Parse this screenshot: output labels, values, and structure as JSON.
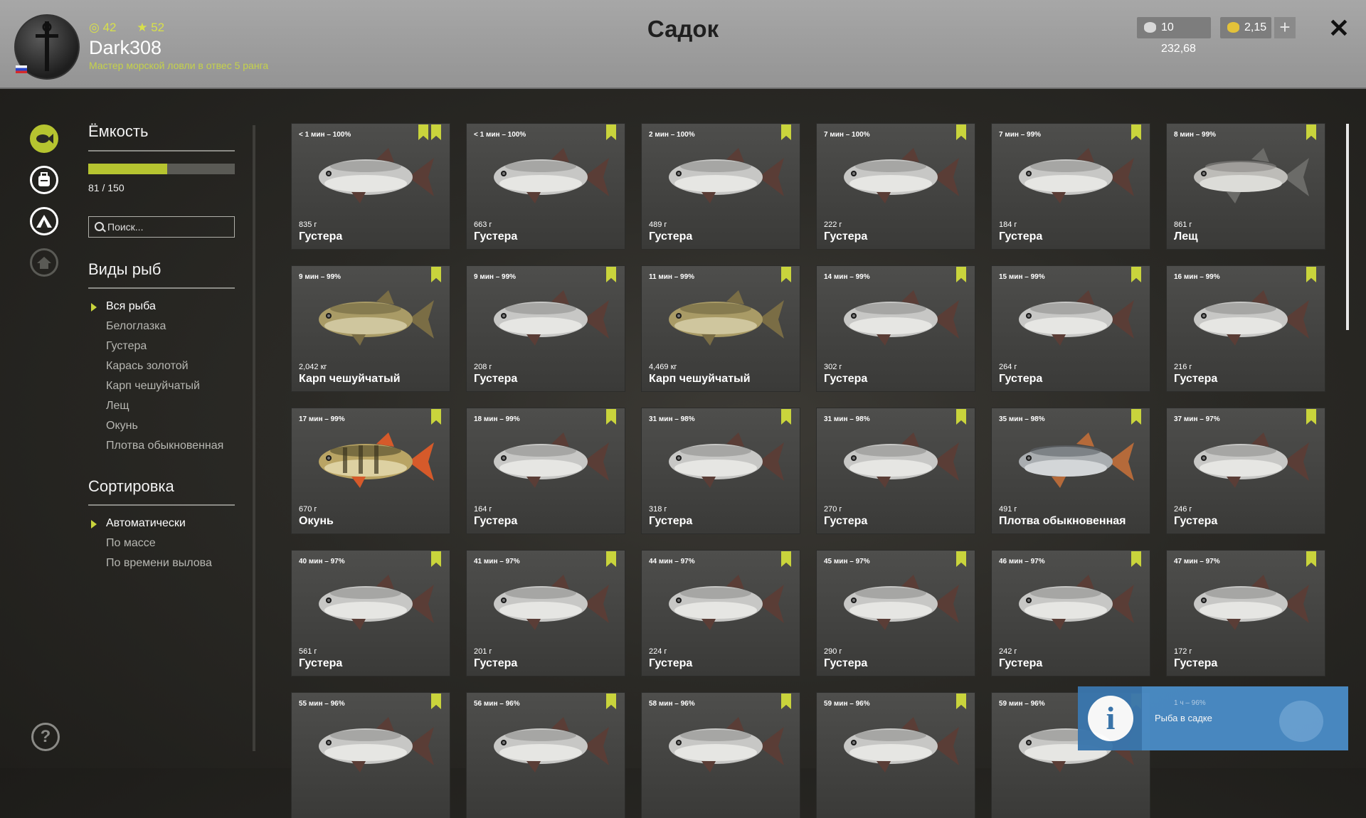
{
  "header": {
    "title": "Садок",
    "player": {
      "level": "42",
      "rank_stars": "52",
      "name": "Dark308",
      "rank_title": "Мастер морской ловли в отвес 5 ранга",
      "flag": "RU"
    },
    "currency": {
      "silver": "10 232,68",
      "gold": "2,15",
      "add_label": "+"
    },
    "close_label": "✕"
  },
  "nav": {
    "icons": [
      "keepnet-fish-icon",
      "backpack-icon",
      "camp-icon",
      "home-icon"
    ],
    "help_label": "?"
  },
  "capacity": {
    "title": "Ёмкость",
    "current": 81,
    "max": 150,
    "text": "81 / 150",
    "search_placeholder": "Поиск..."
  },
  "filters": {
    "title": "Виды рыб",
    "items": [
      "Вся рыба",
      "Белоглазка",
      "Густера",
      "Карась золотой",
      "Карп чешуйчатый",
      "Лещ",
      "Окунь",
      "Плотва обыкновенная"
    ],
    "selected": "Вся рыба"
  },
  "sorting": {
    "title": "Сортировка",
    "items": [
      "Автоматически",
      "По массе",
      "По времени вылова"
    ],
    "selected": "Автоматически"
  },
  "colors": {
    "accent": "#c9d43c",
    "header_bg": "#9e9e9e",
    "toast_bg": "#4a8cc6"
  },
  "fish": [
    {
      "time": "< 1 мин – 100%",
      "weight": "835 г",
      "name": "Густера",
      "kind": "bream",
      "star": true
    },
    {
      "time": "< 1 мин – 100%",
      "weight": "663 г",
      "name": "Густера",
      "kind": "bream"
    },
    {
      "time": "2 мин – 100%",
      "weight": "489 г",
      "name": "Густера",
      "kind": "bream"
    },
    {
      "time": "7 мин – 100%",
      "weight": "222 г",
      "name": "Густера",
      "kind": "bream"
    },
    {
      "time": "7 мин – 99%",
      "weight": "184 г",
      "name": "Густера",
      "kind": "bream"
    },
    {
      "time": "8 мин – 99%",
      "weight": "861 г",
      "name": "Лещ",
      "kind": "lesch"
    },
    {
      "time": "9 мин – 99%",
      "weight": "2,042 кг",
      "name": "Карп чешуйчатый",
      "kind": "carp"
    },
    {
      "time": "9 мин – 99%",
      "weight": "208 г",
      "name": "Густера",
      "kind": "bream"
    },
    {
      "time": "11 мин – 99%",
      "weight": "4,469 кг",
      "name": "Карп чешуйчатый",
      "kind": "carp"
    },
    {
      "time": "14 мин – 99%",
      "weight": "302 г",
      "name": "Густера",
      "kind": "bream"
    },
    {
      "time": "15 мин – 99%",
      "weight": "264 г",
      "name": "Густера",
      "kind": "bream"
    },
    {
      "time": "16 мин – 99%",
      "weight": "216 г",
      "name": "Густера",
      "kind": "bream"
    },
    {
      "time": "17 мин – 99%",
      "weight": "670 г",
      "name": "Окунь",
      "kind": "perch"
    },
    {
      "time": "18 мин – 99%",
      "weight": "164 г",
      "name": "Густера",
      "kind": "bream"
    },
    {
      "time": "31 мин – 98%",
      "weight": "318 г",
      "name": "Густера",
      "kind": "bream"
    },
    {
      "time": "31 мин – 98%",
      "weight": "270 г",
      "name": "Густера",
      "kind": "bream"
    },
    {
      "time": "35 мин – 98%",
      "weight": "491 г",
      "name": "Плотва обыкновенная",
      "kind": "roach"
    },
    {
      "time": "37 мин – 97%",
      "weight": "246 г",
      "name": "Густера",
      "kind": "bream"
    },
    {
      "time": "40 мин – 97%",
      "weight": "561 г",
      "name": "Густера",
      "kind": "bream"
    },
    {
      "time": "41 мин – 97%",
      "weight": "201 г",
      "name": "Густера",
      "kind": "bream"
    },
    {
      "time": "44 мин – 97%",
      "weight": "224 г",
      "name": "Густера",
      "kind": "bream"
    },
    {
      "time": "45 мин – 97%",
      "weight": "290 г",
      "name": "Густера",
      "kind": "bream"
    },
    {
      "time": "46 мин – 97%",
      "weight": "242 г",
      "name": "Густера",
      "kind": "bream"
    },
    {
      "time": "47 мин – 97%",
      "weight": "172 г",
      "name": "Густера",
      "kind": "bream"
    },
    {
      "time": "55 мин – 96%",
      "weight": "",
      "name": "",
      "kind": "bream"
    },
    {
      "time": "56 мин – 96%",
      "weight": "",
      "name": "",
      "kind": "bream"
    },
    {
      "time": "58 мин – 96%",
      "weight": "",
      "name": "",
      "kind": "bream"
    },
    {
      "time": "59 мин – 96%",
      "weight": "",
      "name": "",
      "kind": "bream"
    },
    {
      "time": "59 мин – 96%",
      "weight": "",
      "name": "",
      "kind": "bream"
    }
  ],
  "toast": {
    "icon_label": "i",
    "subtitle": "1 ч – 96%",
    "message": "Рыба в садке"
  }
}
